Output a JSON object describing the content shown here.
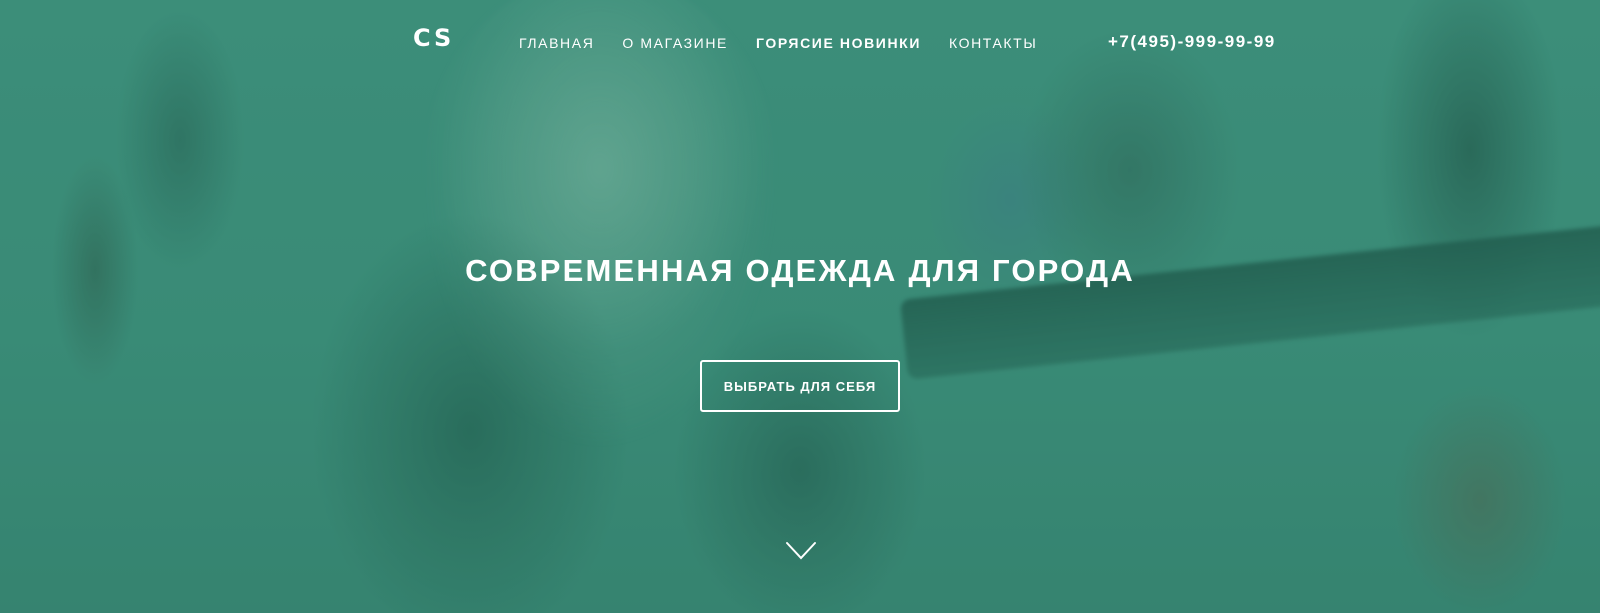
{
  "header": {
    "logo": "CS",
    "nav": [
      {
        "label": "ГЛАВНАЯ",
        "active": false
      },
      {
        "label": "О МАГАЗИНЕ",
        "active": false
      },
      {
        "label": "ГОРЯСИЕ НОВИНКИ",
        "active": true
      },
      {
        "label": "КОНТАКТЫ",
        "active": false
      }
    ],
    "phone": "+7(495)-999-99-99"
  },
  "hero": {
    "headline": "СОВРЕМЕННАЯ ОДЕЖДА ДЛЯ ГОРОДА",
    "cta_label": "ВЫБРАТЬ ДЛЯ СЕБЯ",
    "scroll_icon": "chevron-down-icon"
  },
  "colors": {
    "overlay": "#3e8d7a",
    "text": "#ffffff"
  }
}
